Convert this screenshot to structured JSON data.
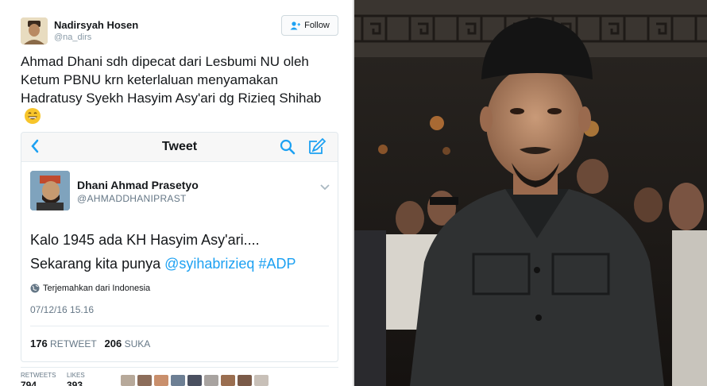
{
  "tweet": {
    "author_name": "Nadirsyah Hosen",
    "author_handle": "@na_dirs",
    "follow_label": "Follow",
    "text": "Ahmad Dhani sdh dipecat dari Lesbumi NU oleh Ketum PBNU krn keterlaluan menyamakan Hadratusy Syekh Hasyim Asy'ari dg Rizieq Shihab",
    "emoji_icon": "grinning-face-emoji"
  },
  "embedded_screenshot": {
    "nav_title": "Tweet",
    "author_name": "Dhani Ahmad Prasetyo",
    "author_handle": "@AHMADDHANIPRAST",
    "line1": "Kalo 1945 ada KH Hasyim Asy'ari....",
    "line2_prefix": "Sekarang kita punya ",
    "mention": "@syihabrizieq",
    "hashtag": "#ADP",
    "translate_label": "Terjemahkan dari Indonesia",
    "datetime": "07/12/16 15.16",
    "retweets_count": "176",
    "retweets_label": "RETWEET",
    "likes_count": "206",
    "likes_label": "SUKA",
    "link_color": "#1da1f2"
  },
  "footer": {
    "retweets_label": "RETWEETS",
    "retweets_count": "794",
    "likes_label": "LIKES",
    "likes_count": "393"
  },
  "photo": {
    "description_icon": "portrait-photo"
  }
}
